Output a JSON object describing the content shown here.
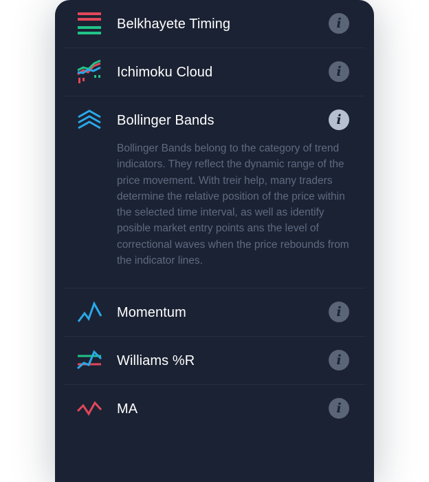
{
  "indicators": [
    {
      "name": "Belkhayete Timing",
      "icon": "belkhayete-timing-icon",
      "expanded": false
    },
    {
      "name": "Ichimoku Cloud",
      "icon": "ichimoku-cloud-icon",
      "expanded": false
    },
    {
      "name": "Bollinger Bands",
      "icon": "bollinger-bands-icon",
      "expanded": true,
      "description": "Bollinger Bands belong to the category of trend indicators. They reflect the dynamic range of the price movement. With treir help, many traders determine the relative position of the price within the selected time interval, as well as identify posible market entry points ans the level of correctional waves when the price rebounds from the indicator lines."
    },
    {
      "name": "Momentum",
      "icon": "momentum-icon",
      "expanded": false
    },
    {
      "name": "Williams %R",
      "icon": "williams-r-icon",
      "expanded": false
    },
    {
      "name": "MA",
      "icon": "moving-average-icon",
      "expanded": false
    }
  ],
  "info_glyph": "i",
  "colors": {
    "panel_bg": "#1b2233",
    "divider": "#262e40",
    "text": "#ffffff",
    "description": "#5f6b82",
    "info_inactive": "#5b6578",
    "info_active": "#b6bfd0",
    "red": "#e2475a",
    "green": "#20c387",
    "blue": "#2aa8e8"
  }
}
